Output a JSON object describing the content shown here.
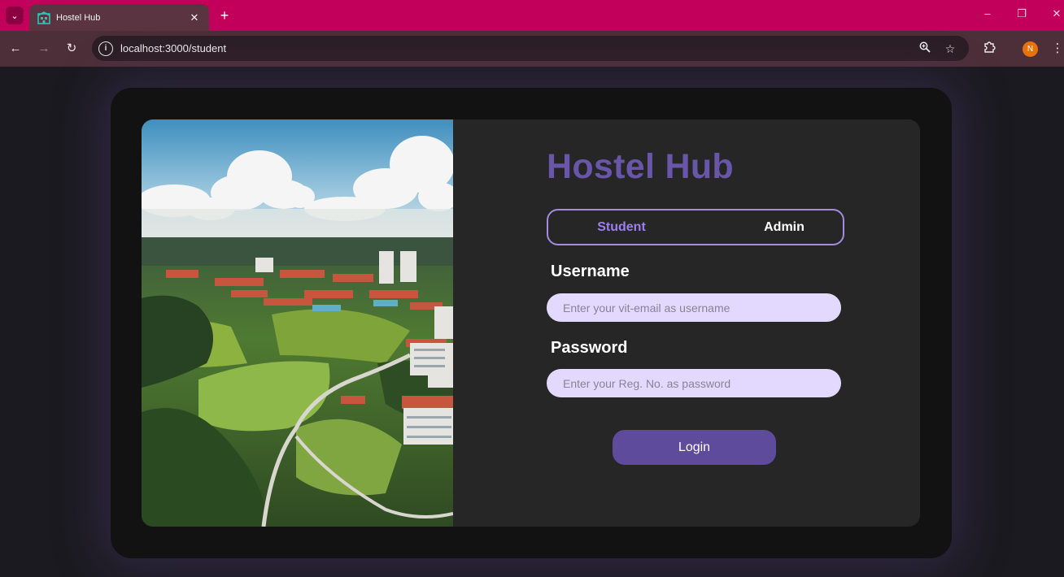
{
  "browser": {
    "tab_title": "Hostel Hub",
    "tab_close": "✕",
    "new_tab": "+",
    "url": "localhost:3000/student",
    "profile_initial": "N",
    "accent_color": "#c2005c"
  },
  "app": {
    "brand": "Hostel Hub",
    "brand_color": "#6a56a8"
  },
  "login_form": {
    "role_toggle": {
      "options": [
        "Student",
        "Admin"
      ],
      "selected": "Student"
    },
    "username_label": "Username",
    "username_placeholder": "Enter your vit-email as username",
    "username_value": "",
    "password_label": "Password",
    "password_placeholder": "Enter your Reg. No. as password",
    "password_value": "",
    "login_label": "Login"
  },
  "icons": {
    "tab_menu": "chevron-down-icon",
    "favicon": "hostel-icon",
    "back": "arrow-left-icon",
    "forward": "arrow-right-icon",
    "reload": "reload-icon",
    "site_info": "info-icon",
    "zoom": "zoom-icon",
    "bookmark": "star-icon",
    "extensions": "puzzle-icon",
    "menu": "more-vert-icon"
  }
}
